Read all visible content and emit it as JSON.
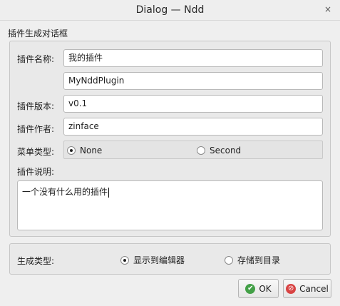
{
  "window": {
    "title": "Dialog — Ndd",
    "close_glyph": "×"
  },
  "group": {
    "title": "插件生成对话框"
  },
  "form": {
    "name_label": "插件名称:",
    "name_value": "我的插件",
    "class_value": "MyNddPlugin",
    "version_label": "插件版本:",
    "version_value": "v0.1",
    "author_label": "插件作者:",
    "author_value": "zinface",
    "menu_type_label": "菜单类型:",
    "menu_type_options": [
      "None",
      "Second"
    ],
    "menu_type_selected": "None",
    "desc_label": "插件说明:",
    "desc_value": "一个没有什么用的插件"
  },
  "generate": {
    "label": "生成类型:",
    "options": [
      "显示到编辑器",
      "存储到目录"
    ],
    "selected": "显示到编辑器"
  },
  "buttons": {
    "ok": "OK",
    "cancel": "Cancel"
  },
  "icons": {
    "ok": "ok-check-icon",
    "cancel": "cancel-circle-icon"
  }
}
